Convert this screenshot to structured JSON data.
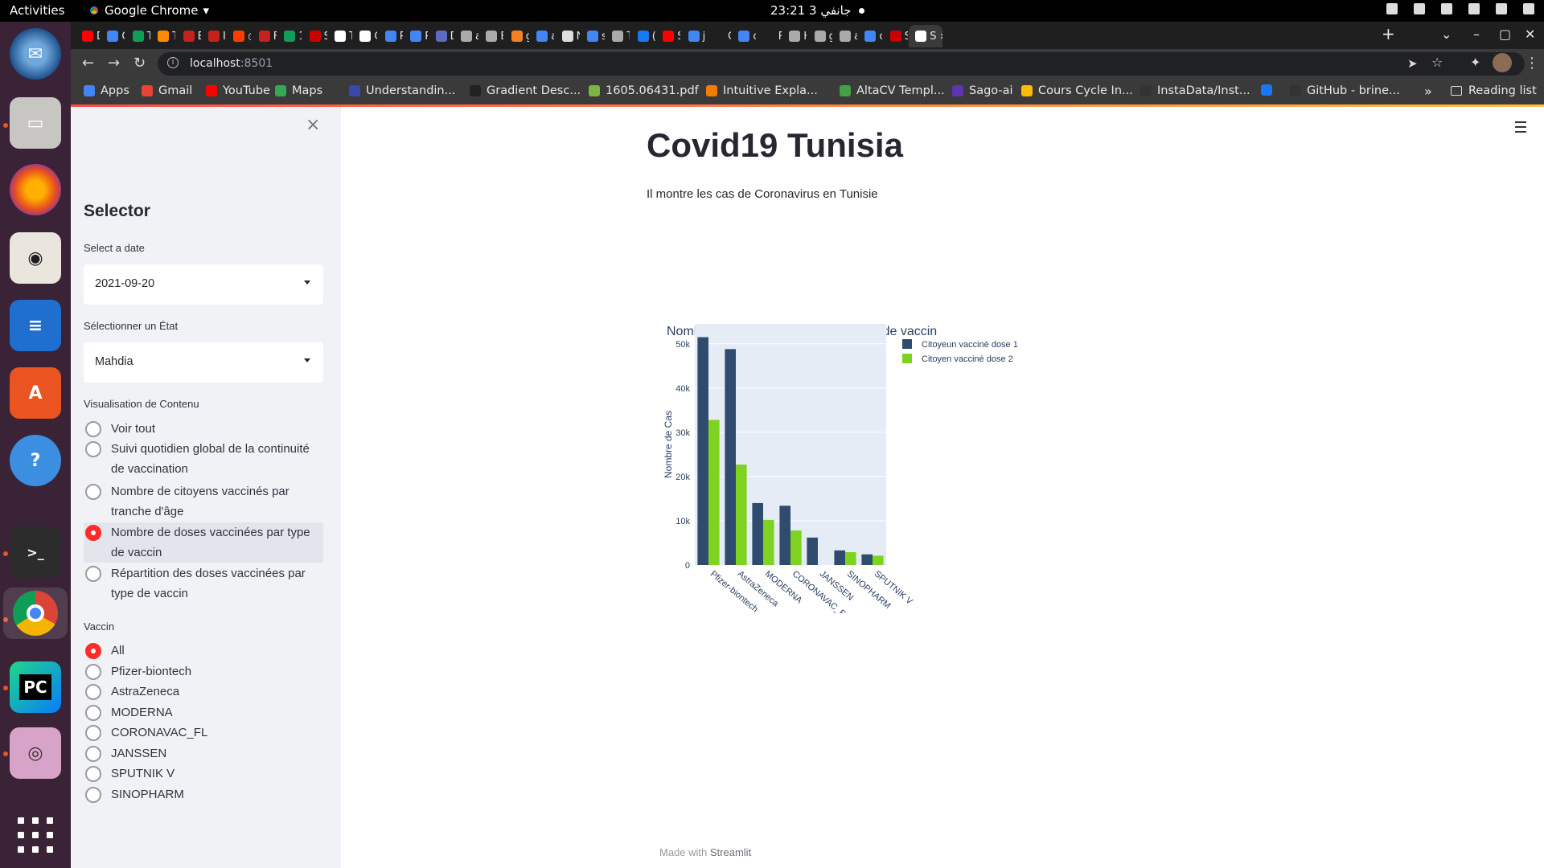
{
  "system": {
    "activities": "Activities",
    "app_name": "Google Chrome",
    "clock": "جانفي 3  23:21"
  },
  "browser": {
    "tabs": [
      {
        "label": "D",
        "color": "#ff0000"
      },
      {
        "label": "C",
        "color": "#4285f4"
      },
      {
        "label": "T",
        "color": "#0f9d58"
      },
      {
        "label": "T",
        "color": "#ff8a00"
      },
      {
        "label": "E",
        "color": "#c5221f"
      },
      {
        "label": "In",
        "color": "#c5221f"
      },
      {
        "label": "◎",
        "color": "#ff3d00"
      },
      {
        "label": "F",
        "color": "#c5221f"
      },
      {
        "label": "1",
        "color": "#0f9d58"
      },
      {
        "label": "S",
        "color": "#cc0000"
      },
      {
        "label": "T",
        "color": "#ffffff"
      },
      {
        "label": "C",
        "color": "#ffffff"
      },
      {
        "label": "P",
        "color": "#4285f4"
      },
      {
        "label": "P",
        "color": "#4285f4"
      },
      {
        "label": "D",
        "color": "#5c6bc0"
      },
      {
        "label": "a",
        "color": "#aaaaaa"
      },
      {
        "label": "E",
        "color": "#aaaaaa"
      },
      {
        "label": "g",
        "color": "#f48024"
      },
      {
        "label": "a",
        "color": "#4285f4"
      },
      {
        "label": "N",
        "color": "#dddddd"
      },
      {
        "label": "s",
        "color": "#4285f4"
      },
      {
        "label": "T",
        "color": "#aaaaaa"
      },
      {
        "label": "(",
        "color": "#1877f2"
      },
      {
        "label": "S",
        "color": "#ff0000"
      },
      {
        "label": "je",
        "color": "#4285f4"
      },
      {
        "label": "C",
        "color": "#1f1f1f"
      },
      {
        "label": "c",
        "color": "#4285f4"
      },
      {
        "label": "R",
        "color": "#1f1f1f"
      },
      {
        "label": "H",
        "color": "#aaaaaa"
      },
      {
        "label": "g",
        "color": "#aaaaaa"
      },
      {
        "label": "a",
        "color": "#aaaaaa"
      },
      {
        "label": "c",
        "color": "#4285f4"
      },
      {
        "label": "S",
        "color": "#cc0000"
      },
      {
        "label": "S",
        "color": "#ffffff"
      }
    ],
    "url_host": "localhost",
    "url_port": ":8501",
    "bookmarks": [
      {
        "label": "Apps",
        "color": "#4285f4"
      },
      {
        "label": "Gmail",
        "color": "#ea4335"
      },
      {
        "label": "YouTube",
        "color": "#ff0000"
      },
      {
        "label": "Maps",
        "color": "#34a853"
      },
      {
        "label": "Understandin...",
        "color": "#3949ab"
      },
      {
        "label": "Gradient Desc...",
        "color": "#222222"
      },
      {
        "label": "1605.06431.pdf",
        "color": "#7cb342"
      },
      {
        "label": "Intuitive Expla...",
        "color": "#f57c00"
      },
      {
        "label": "AltaCV Templ...",
        "color": "#43a047"
      },
      {
        "label": "Sago-ai",
        "color": "#5e35b1"
      },
      {
        "label": "Cours Cycle In...",
        "color": "#fbbc04"
      },
      {
        "label": "InstaData/Inst...",
        "color": "#333333"
      },
      {
        "label": "",
        "color": "#1877f2"
      },
      {
        "label": "GitHub - brine...",
        "color": "#333333"
      }
    ],
    "more": "»",
    "reading_list": "Reading list"
  },
  "sidebar": {
    "close": "×",
    "title": "Selector",
    "date_label": "Select a date",
    "date_value": "2021-09-20",
    "state_label": "Sélectionner un État",
    "state_value": "Mahdia",
    "content_label": "Visualisation de Contenu",
    "content_options": [
      "Voir tout",
      "Suivi quotidien global de la continuité de vaccination",
      "Nombre de citoyens vaccinés par tranche d'âge",
      "Nombre de doses vaccinées par type de vaccin",
      "Répartition des doses vaccinées par type de vaccin"
    ],
    "content_selected": 3,
    "vaccine_label": "Vaccin",
    "vaccine_options": [
      "All",
      "Pfizer-biontech",
      "AstraZeneca",
      "MODERNA",
      "CORONAVAC_FL",
      "JANSSEN",
      "SPUTNIK V",
      "SINOPHARM"
    ],
    "vaccine_selected": 0
  },
  "main": {
    "title": "Covid19 Tunisia",
    "subtitle": "Il montre les cas de Coronavirus en Tunisie",
    "footer_prefix": "Made with ",
    "footer_brand": "Streamlit"
  },
  "chart_data": {
    "type": "bar",
    "title": "Nombre de doses vaccinées par type de vaccin",
    "xlabel": "",
    "ylabel": "Nombre de Cas",
    "categories": [
      "Pfizer-biontech",
      "AstraZeneca",
      "MODERNA",
      "CORONAVAC_FL",
      "JANSSEN",
      "SINOPHARM",
      "SPUTNIK V"
    ],
    "series": [
      {
        "name": "Citoyeun vacciné dose 1",
        "color": "#2f4b6e",
        "values": [
          51500,
          48800,
          14000,
          13400,
          6200,
          3300,
          2400
        ]
      },
      {
        "name": "Citoyen vacciné dose 2",
        "color": "#7ed321",
        "values": [
          32800,
          22700,
          10200,
          7800,
          0,
          2900,
          2100
        ]
      }
    ],
    "ylim": [
      0,
      54500
    ],
    "yticks": [
      0,
      10000,
      20000,
      30000,
      40000,
      50000
    ],
    "ytick_labels": [
      "0",
      "10k",
      "20k",
      "30k",
      "40k",
      "50k"
    ],
    "grid": true,
    "legend": "right"
  }
}
